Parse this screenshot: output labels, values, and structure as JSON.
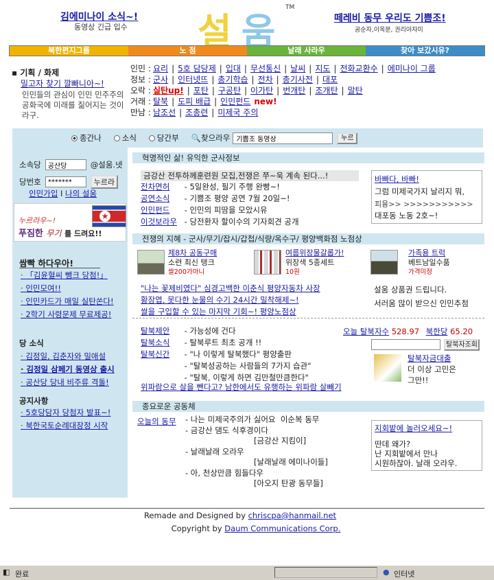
{
  "header": {
    "left_title": "김에미나이 소식~!",
    "left_sub": "동영상 긴급 입수",
    "logo": "설움",
    "tm": "TM",
    "right_title": "떼레비 동무 우리도 기쁨조!",
    "right_sub": "공순자,이옥분, 권리아자미"
  },
  "nav": [
    {
      "label": "북한편지그룹",
      "color": "#f0b400"
    },
    {
      "label": "노 점",
      "color": "#f08a1e"
    },
    {
      "label": "날래 사라우",
      "color": "#6ab43c"
    },
    {
      "label": "찾아 보갔시유?",
      "color": "#3c8cc8"
    }
  ],
  "topic": {
    "head": "기획 / 화제",
    "link": "밀고자 찾기 깔빠니아~!",
    "desc": "인민들의 관심이 인민 민주주의 공화국에 미래를 짊어지는 것이라구."
  },
  "cats": [
    {
      "label": "인민 :",
      "items": [
        "요리",
        "5호 담당제",
        "입대",
        "무선통신",
        "날씨",
        "지도",
        "전화교환수",
        "에미나이 그룹"
      ]
    },
    {
      "label": "정보 :",
      "items": [
        "군사",
        "인터넷뜨",
        "총기학습",
        "전차",
        "총기사전",
        "대포"
      ]
    },
    {
      "label": "오락 :",
      "items": [
        "실탄up!",
        "포탄",
        "구공탄",
        "이가탄",
        "번개탄",
        "조개탄",
        "말탄"
      ]
    },
    {
      "label": "거래 :",
      "items": [
        "탈북",
        "도피 배급",
        "인민펀드"
      ],
      "new": "new!"
    },
    {
      "label": "만남 :",
      "items": [
        "남조선",
        "조총련",
        "미제국 주의"
      ]
    }
  ],
  "search": {
    "opt1": "종간나",
    "opt2": "소식",
    "opt3": "당간부",
    "opt4": "찾으라우",
    "value": "기쁨조 동영상",
    "button": "누르"
  },
  "login": {
    "id_label": "소속당",
    "id_value": "공산당",
    "domain": "@설움.넷",
    "pw_label": "당번호",
    "pw_value": "*******",
    "button": "누르라",
    "join": "인민가입",
    "sep": "I",
    "mine": "나의 설움"
  },
  "promo": {
    "l1": "누르라우~!",
    "l2a": "푸짐한",
    "l2b": "무기",
    "l2c": "를 드려요!!"
  },
  "left_sections": {
    "hot_title": "쌈빡 하다우아!",
    "hot": [
      "「김윤혈씨 뺑크 당첨!」",
      "인민모여!!",
      "인민카드가 매일 실탄쏜다!",
      "2학기 사령문제 무료제공!"
    ],
    "party_title": "당 소식",
    "party": [
      "김정일, 김춘자와 밀애설",
      "김정일 삼페기 동영상 출시",
      "공산당 당내 비주류 격돌!"
    ],
    "notice_title": "공지사항",
    "notice": [
      "5호당담자 당첨자 발표~!",
      "북한국토순례대장정 시작"
    ]
  },
  "center": {
    "sec1": "혁명적인 삶! 유익한 군사정보",
    "scoop": "금강산 전투하께훈련원 모집,전쟁은 쭈~욱 계속 된다...!",
    "info": [
      {
        "k": "전차면허",
        "v": "- 5일완성, 필기 주행 완빵~!"
      },
      {
        "k": "공연소식",
        "v": "- 기쁨조 평양 공연 7월 20일~!"
      },
      {
        "k": "인민펀드",
        "v": "- 인민의 피땀을 모았시유"
      },
      {
        "k": "이것보라우",
        "v": "- 당전환자 할이수의 기자회견 공개"
      }
    ],
    "side1_title": "바빠다, 바빠!",
    "side1_l1": "그럼 미제국가지 날리지 뭐,",
    "side1_l2": "피융>> >>>>>>>>>>>",
    "side1_l3": "대포동 노동 2호~!",
    "sec2": "전쟁의 지혜 - 군사/무기/잡시/갑첩/식량/옥수구/ 평양백화점 노점상",
    "products": [
      {
        "title": "제8차 공동구매",
        "desc": "소련 최신 탱크",
        "price": "쌀200가마니"
      },
      {
        "title": "여름위장물갈롭가!",
        "desc": "위장색 5종세트",
        "price": "10원"
      },
      {
        "title": "가족용 트럭",
        "desc": "베트남일수품",
        "price": "가격미정"
      }
    ],
    "quotes": [
      "\"나는 꽃제비였다\" 심경고백한 이춘식 평양자동차 사장",
      "황장엽, 못다한 눈물의 수기 24시간 밀착해제~!",
      "쌀을 구입할 수 있는 마지막 기회~! 평양노점상"
    ],
    "shop1": "설움 상품권 드립니다.",
    "shop2": "서러움 많이 받으신 인민추첨",
    "defect": [
      {
        "k": "탈북제안",
        "v": "- 가능성에 건다"
      },
      {
        "k": "탈북소식",
        "v": "- 탈북루트 최초 공개 !!"
      },
      {
        "k": "탈북신간",
        "v": "- \"나 이렇게 탈북했다\" 평양출판"
      },
      {
        "k": "",
        "v": "- \"탈북성공하는 사람들의 7가지 습관\""
      },
      {
        "k": "",
        "v": "- \"탈북, 이렇게 하면 김만철만큼한다\""
      }
    ],
    "defect_link": "위파람으로 살을 뺀다고? 남한에서도 유행하는 위파람 살빼기",
    "today_label": "오늘 탈북자수",
    "today_val": "528.97",
    "nk_label": "북한당",
    "nk_val": "65.20",
    "calc_btn": "탈북자조회",
    "loan_title": "탈북자금대출",
    "loan_l1": "더 이상 고민은",
    "loan_l2": "그만!!",
    "sec3": "종요로운 공동체",
    "comm_label": "오늘의 동무",
    "comm": [
      {
        "v": "- 나는 미제국주의가 싫어요",
        "w": "이순복 동무"
      },
      {
        "v": "- 금강산 댐도 식후경이다",
        "w": "[금강산 지킴이]"
      },
      {
        "v": "- 날래날래 오라우",
        "w": "[날래날래 에미나이들]"
      },
      {
        "v": "- 아, 천상만큼 힘들다우",
        "w": "[아오지 탄광 동무들]"
      }
    ],
    "side3_title": "지회밭에 놀러오세요~!",
    "side3_l1": "딴데 왜가?",
    "side3_l2": "난 지회밭에서 만나",
    "side3_l3": "시원하잖아. 날래 오라우."
  },
  "footer": {
    "remade": "Remade and Designed by",
    "email": "chriscpa@hanmail.net",
    "copyright": "Copyright by",
    "company": "Daum Communications Corp."
  },
  "status": {
    "done": "완료",
    "zone": "인터넷"
  }
}
